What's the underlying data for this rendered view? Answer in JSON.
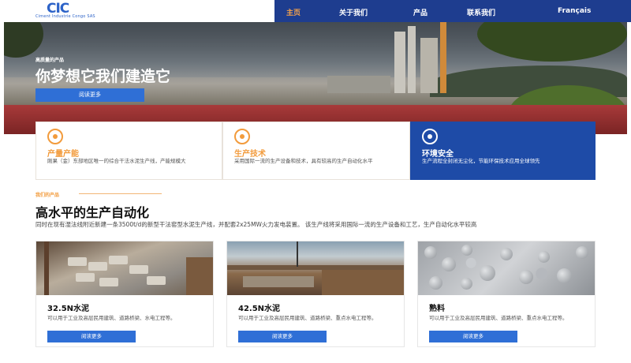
{
  "nav": {
    "logo_text": "CIC",
    "logo_sub": "Ciment Industrie Congo SAS",
    "items": [
      "主页",
      "关于我们",
      "产品",
      "联系我们",
      "Français"
    ],
    "active_index": 0
  },
  "hero": {
    "kicker": "高质量的产品",
    "headline": "你梦想它我们建造它",
    "button": "阅读更多"
  },
  "features": [
    {
      "icon": "cement-icon",
      "title": "产量产能",
      "desc": "刚果（金）东部地区唯一的综合干法水泥生产线，产能规模大"
    },
    {
      "icon": "gear-icon",
      "title": "生产技术",
      "desc": "采用国际一流的生产设备和技术，具有较高的生产自动化水平"
    },
    {
      "icon": "globe-icon",
      "title": "环境安全",
      "desc": "生产流程全封闭无尘化，节能环保技术应用全球领先"
    }
  ],
  "products_section": {
    "kicker": "我们的产品",
    "title": "高水平的生产自动化",
    "desc": "同时在现有湿法线附近新建一条3500t/d的新型干法窑型水泥生产线，并配套2x25MW火力发电装置。 该生产线将采用国际一流的生产设备和工艺，生产自动化水平较高"
  },
  "products": [
    {
      "title": "32.5N水泥",
      "desc": "可以用于工业及高层民用建筑、道路桥梁、水电工程等。",
      "button": "阅读更多"
    },
    {
      "title": "42.5N水泥",
      "desc": "可以用于工业及高层民用建筑、道路桥梁、重点水电工程等。",
      "button": "阅读更多"
    },
    {
      "title": "熟料",
      "desc": "可以用于工业及高层民用建筑、道路桥梁、重点水电工程等。",
      "button": "阅读更多"
    }
  ],
  "colors": {
    "nav_blue": "#1e3d8f",
    "accent_orange": "#f29b3c",
    "button_blue": "#2f6fd6",
    "feature_highlight": "#1e4ba7"
  }
}
